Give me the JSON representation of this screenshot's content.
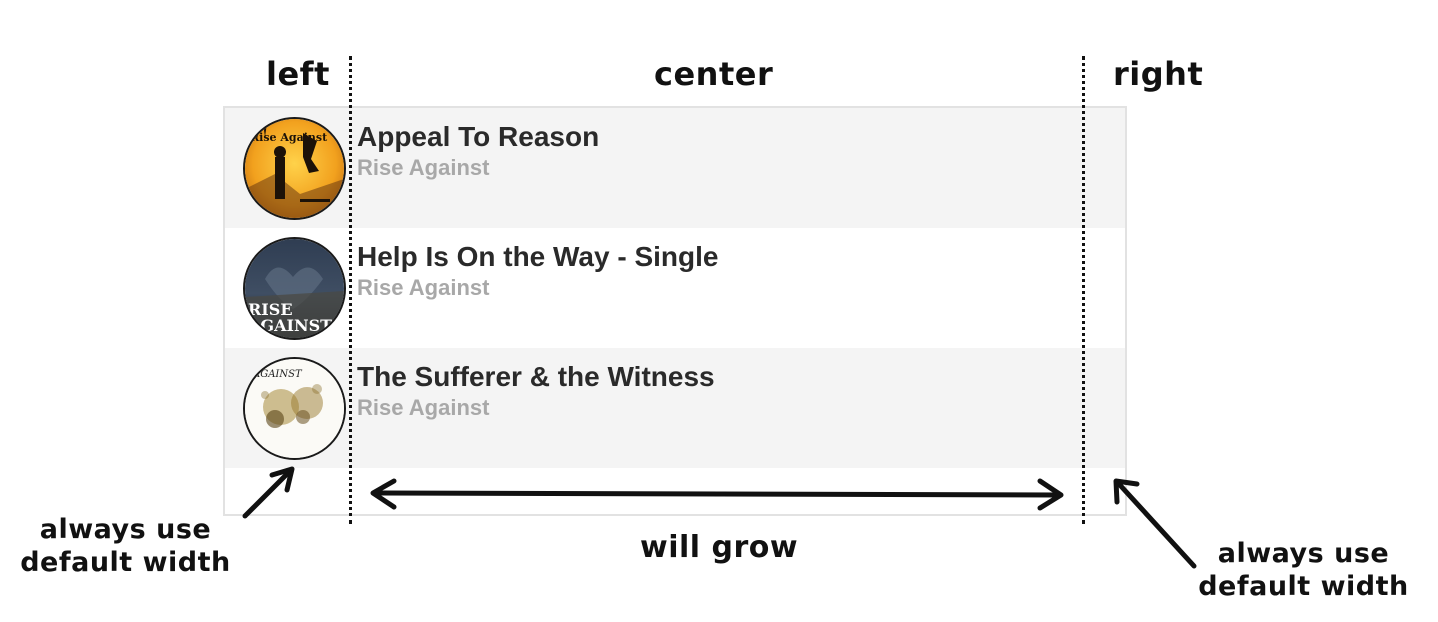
{
  "columns": {
    "left": "left",
    "center": "center",
    "right": "right"
  },
  "list_items": [
    {
      "title": "Appeal To Reason",
      "subtitle": "Rise Against",
      "avatar_icon": "album-cover-appeal-to-reason"
    },
    {
      "title": "Help Is On the Way - Single",
      "subtitle": "Rise Against",
      "avatar_icon": "album-cover-help-is-on-the-way"
    },
    {
      "title": "The Sufferer & the Witness",
      "subtitle": "Rise Against",
      "avatar_icon": "album-cover-sufferer-and-witness"
    }
  ],
  "annotations": {
    "left_note": [
      "always use",
      "default width"
    ],
    "grow_note": "will grow",
    "right_note": [
      "always use",
      "default width"
    ]
  },
  "album_art_text": {
    "item_1": "Rise Against",
    "item_2_line1": "RISE",
    "item_2_line2": "AGAINST",
    "item_3": "AGAINST"
  },
  "colors": {
    "row_shaded": "#f4f4f4",
    "row_plain": "#ffffff",
    "title": "#2a2a2a",
    "subtitle": "#a8a8a8",
    "ink": "#111111"
  }
}
